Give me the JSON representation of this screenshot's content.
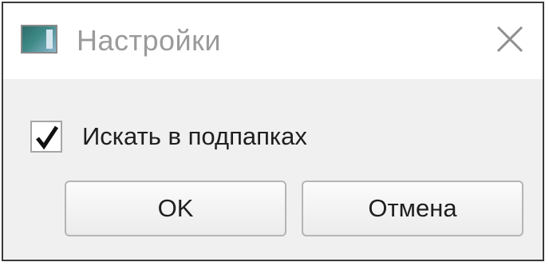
{
  "window": {
    "title": "Настройки",
    "icon": "app-window-icon",
    "close_icon": "close-icon"
  },
  "options": {
    "search_subfolders": {
      "label": "Искать в подпапках",
      "checked": true
    }
  },
  "buttons": {
    "ok_label": "OK",
    "cancel_label": "Отмена"
  }
}
